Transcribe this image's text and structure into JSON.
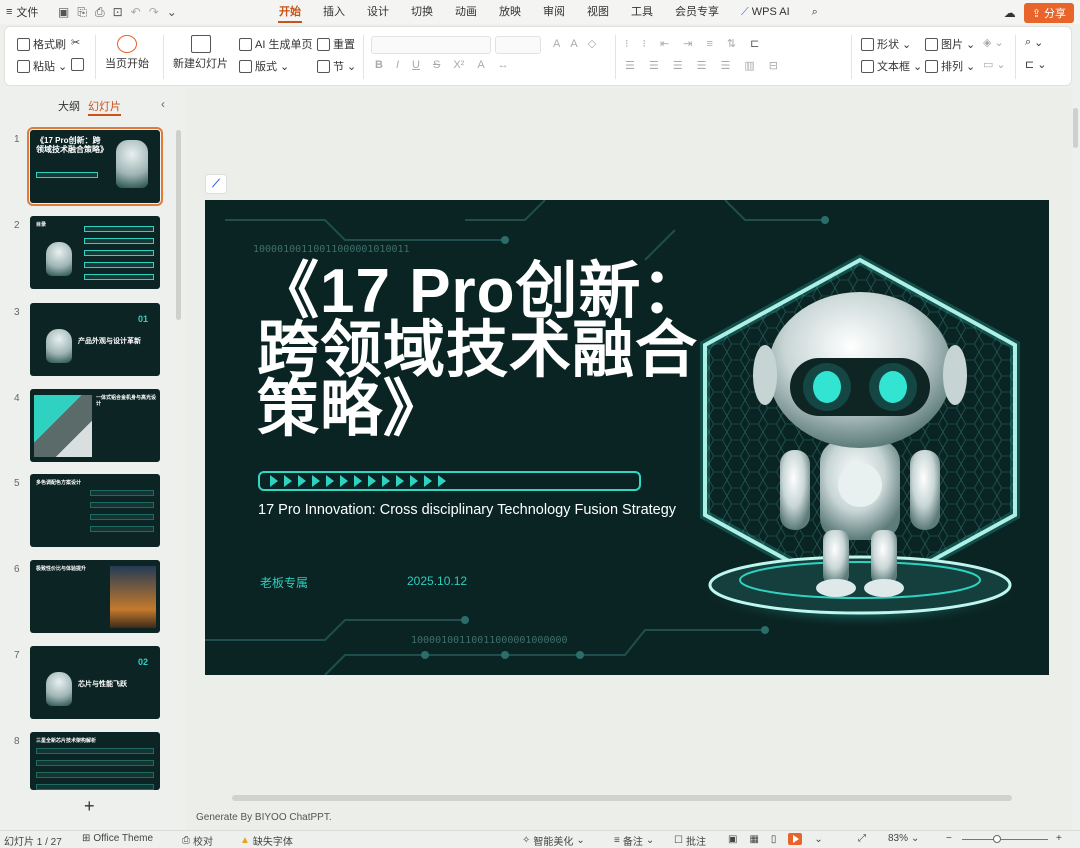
{
  "menubar": {
    "file": "文件",
    "tabs": [
      "开始",
      "插入",
      "设计",
      "切换",
      "动画",
      "放映",
      "审阅",
      "视图",
      "工具",
      "会员专享",
      "WPS AI"
    ],
    "active_tab": "开始",
    "share": "分享"
  },
  "ribbon": {
    "format_painter": "格式刷",
    "paste": "粘贴",
    "play_from_current": "当页开始",
    "new_slide": "新建幻灯片",
    "ai_generate": "AI 生成单页",
    "layout": "版式",
    "reset": "重置",
    "section": "节",
    "shape": "形状",
    "picture": "图片",
    "textbox": "文本框",
    "arrange": "排列",
    "font_placeholder": "",
    "font_size_placeholder": ""
  },
  "left_panel": {
    "tab_outline": "大纲",
    "tab_slides": "幻灯片",
    "slides": [
      {
        "num": "1",
        "title": "《17 Pro创新：跨领域技术融合策略》"
      },
      {
        "num": "2",
        "title": "目录"
      },
      {
        "num": "3",
        "title": "产品外观与设计革新",
        "label": "01"
      },
      {
        "num": "4",
        "title": "一体式铝合金机身与高光设计"
      },
      {
        "num": "5",
        "title": "多色调配色方案设计"
      },
      {
        "num": "6",
        "title": "极致性价比与体验提升"
      },
      {
        "num": "7",
        "title": "芯片与性能飞跃",
        "label": "02"
      },
      {
        "num": "8",
        "title": "三星全新芯片技术架构解析"
      }
    ]
  },
  "slide": {
    "title": "《17 Pro创新：\n跨领域技术融合\n策略》",
    "subtitle": "17 Pro Innovation: Cross disciplinary Technology Fusion Strategy",
    "author": "老板专属",
    "date": "2025.10.12",
    "binary_top": "10000100110011000001010011",
    "binary_bottom": "10000100110011000001000000"
  },
  "notes": "Generate By BIYOO ChatPPT.",
  "statusbar": {
    "slide_counter": "幻灯片 1 / 27",
    "theme": "Office Theme",
    "proofread": "校对",
    "missing_font": "缺失字体",
    "smart_beautify": "智能美化",
    "notes": "备注",
    "comments": "批注",
    "zoom": "83%"
  },
  "colors": {
    "accent": "#c9511a",
    "slide_bg": "#0a2423",
    "teal": "#2fd1c0"
  }
}
